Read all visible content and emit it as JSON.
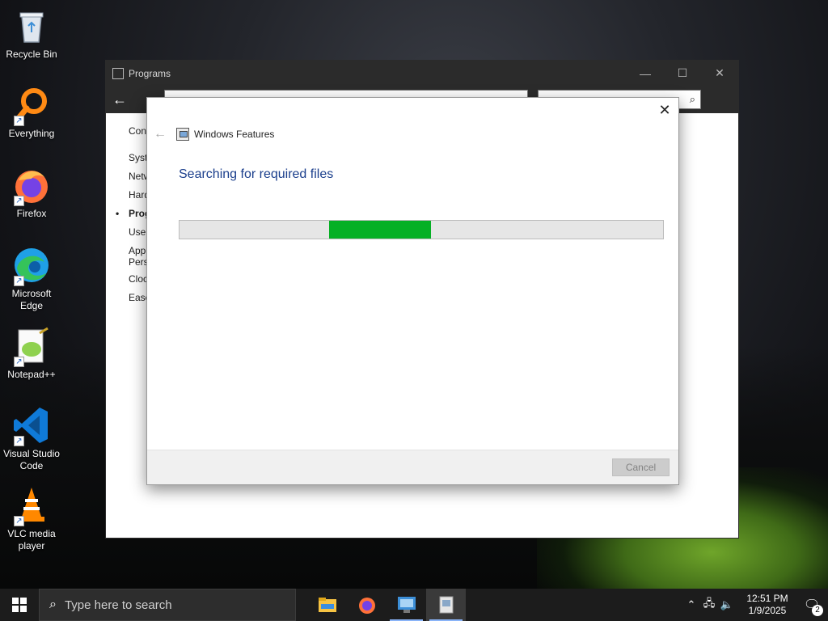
{
  "desktop": {
    "icons": [
      {
        "label": "Recycle Bin",
        "icon": "recycle-bin-icon"
      },
      {
        "label": "Everything",
        "icon": "everything-search-icon"
      },
      {
        "label": "Firefox",
        "icon": "firefox-icon"
      },
      {
        "label": "Microsoft Edge",
        "icon": "edge-icon"
      },
      {
        "label": "Notepad++",
        "icon": "notepad-plus-plus-icon"
      },
      {
        "label": "Visual Studio Code",
        "icon": "vscode-icon"
      },
      {
        "label": "VLC media player",
        "icon": "vlc-icon"
      }
    ]
  },
  "control_panel": {
    "title": "Programs",
    "sidebar": [
      "Con",
      "Syst",
      "Netw",
      "Hard",
      "Prog",
      "User",
      "App Pers",
      "Cloc",
      "Ease"
    ],
    "active_index": 4
  },
  "dialog": {
    "title": "Windows Features",
    "heading": "Searching for required files",
    "progress_percent": 21,
    "cancel_label": "Cancel",
    "close_glyph": "✕",
    "back_glyph": "←"
  },
  "taskbar": {
    "search_placeholder": "Type here to search",
    "apps": [
      "file-explorer-icon",
      "firefox-icon",
      "control-panel-icon",
      "windows-features-icon"
    ],
    "time": "12:51 PM",
    "date": "1/9/2025",
    "notification_count": "2"
  },
  "colors": {
    "progress_green": "#06b025",
    "heading_blue": "#1a3e8c",
    "taskbar_bg": "#1c1c1c"
  }
}
